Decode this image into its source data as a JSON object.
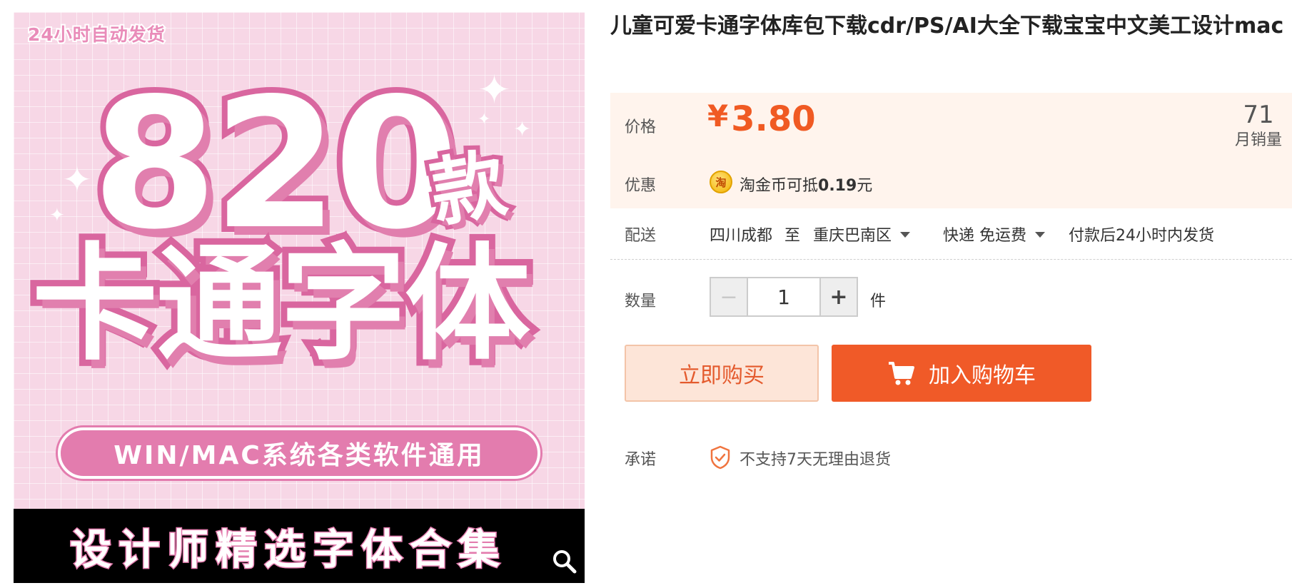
{
  "gallery": {
    "badge": "24小时自动发货",
    "headline_number": "820",
    "headline_unit": "款",
    "headline_text": "卡通字体",
    "system_pill": "WIN/MAC系统各类软件通用",
    "footer_text": "设计师精选字体合集",
    "zoom_icon": "search-icon"
  },
  "product": {
    "title": "儿童可爱卡通字体库包下载cdr/PS/AI大全下载宝宝中文美工设计mac"
  },
  "price": {
    "label": "价格",
    "currency": "¥",
    "value": "3.80",
    "sales_count": "71",
    "sales_label": "月销量",
    "color": "#f05a23"
  },
  "promo": {
    "label": "优惠",
    "coin_glyph": "淘",
    "text_prefix": "淘金币可抵",
    "amount": "0.19",
    "text_suffix": "元"
  },
  "shipping": {
    "label": "配送",
    "from": "四川成都",
    "to_word": "至",
    "destination": "重庆巴南区",
    "method": "快递 免运费",
    "dispatch": "付款后24小时内发货"
  },
  "quantity": {
    "label": "数量",
    "value": "1",
    "unit": "件",
    "minus": "−",
    "plus": "+"
  },
  "actions": {
    "buy_now": "立即购买",
    "add_to_cart": "加入购物车",
    "accent": "#f05a28"
  },
  "promise": {
    "label": "承诺",
    "text": "不支持7天无理由退货"
  }
}
